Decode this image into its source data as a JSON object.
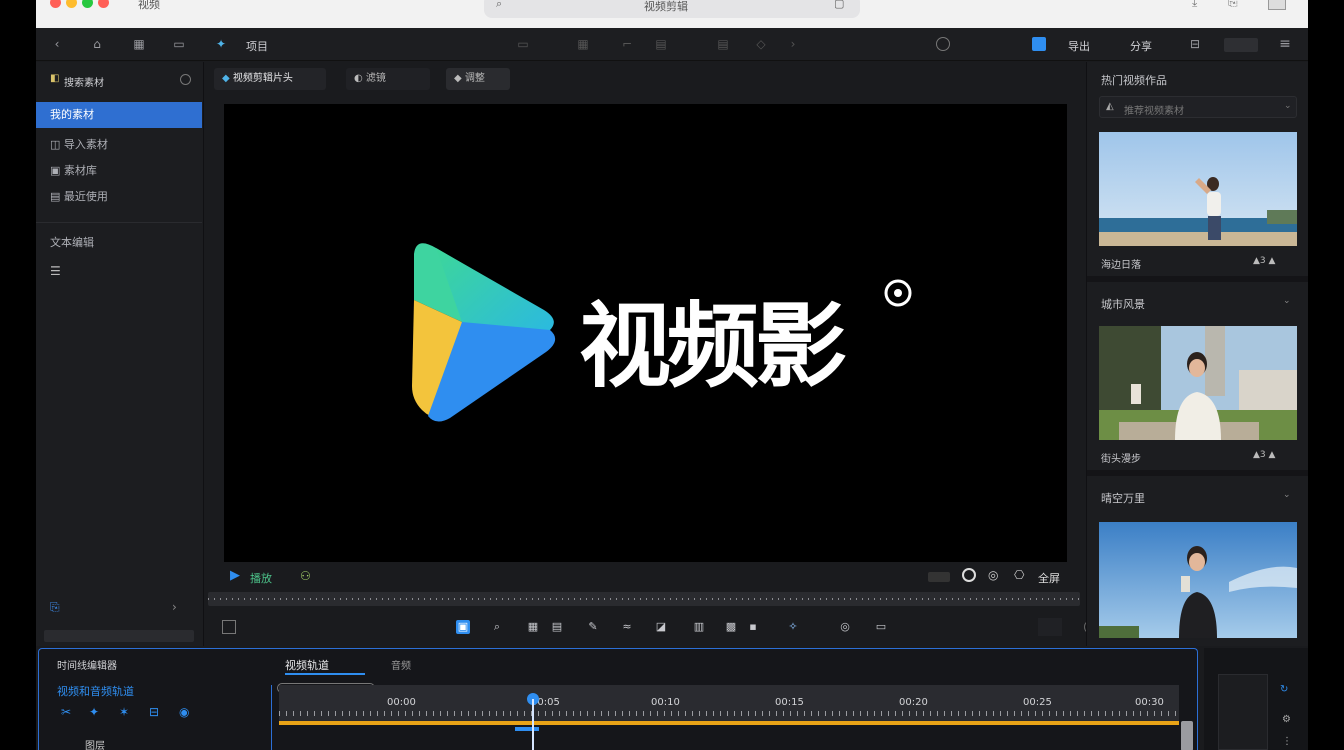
{
  "window": {
    "title": "视频剪辑",
    "search_placeholder": "搜索素材",
    "mac_title_left": "视频"
  },
  "toolbar": {
    "project_label": "项目",
    "export_label": "导出",
    "share_label": "分享",
    "share_color": "#2f8ef0"
  },
  "left_panel": {
    "search_label": "搜索素材",
    "items": [
      {
        "label": "我的素材",
        "active": true
      },
      {
        "label": "导入素材",
        "active": false
      },
      {
        "label": "素材库",
        "active": false
      },
      {
        "label": "最近使用",
        "active": false
      }
    ],
    "section2_label": "文本编辑"
  },
  "center": {
    "tabs": [
      {
        "label": "视频剪辑片头"
      },
      {
        "label": "滤镜"
      },
      {
        "label": "调整"
      }
    ],
    "brand_text": "视频影",
    "preview_bg": "#000000",
    "play_label": "播放",
    "fullscreen_label": "全屏",
    "accent": "#2f8ef0"
  },
  "right_panel": {
    "header": "热门视频作品",
    "dropdown": "推荐视频素材",
    "cards": [
      {
        "heading": "",
        "caption": "海边日落",
        "meta": "▲3 ▲"
      },
      {
        "heading": "城市风景",
        "caption": "街头漫步",
        "meta": "▲3 ▲"
      },
      {
        "heading": "晴空万里",
        "caption": "",
        "meta": ""
      }
    ]
  },
  "timeline": {
    "title": "时间线编辑器",
    "tab_active": "视频轨道",
    "tab_2": "音频",
    "track_label": "视频和音频轨道",
    "layer_label": "图层",
    "ruler_labels": [
      "00:00",
      "00:05",
      "00:10",
      "00:15",
      "00:20",
      "00:25",
      "00:30"
    ],
    "progress_color": "#e8a317"
  }
}
